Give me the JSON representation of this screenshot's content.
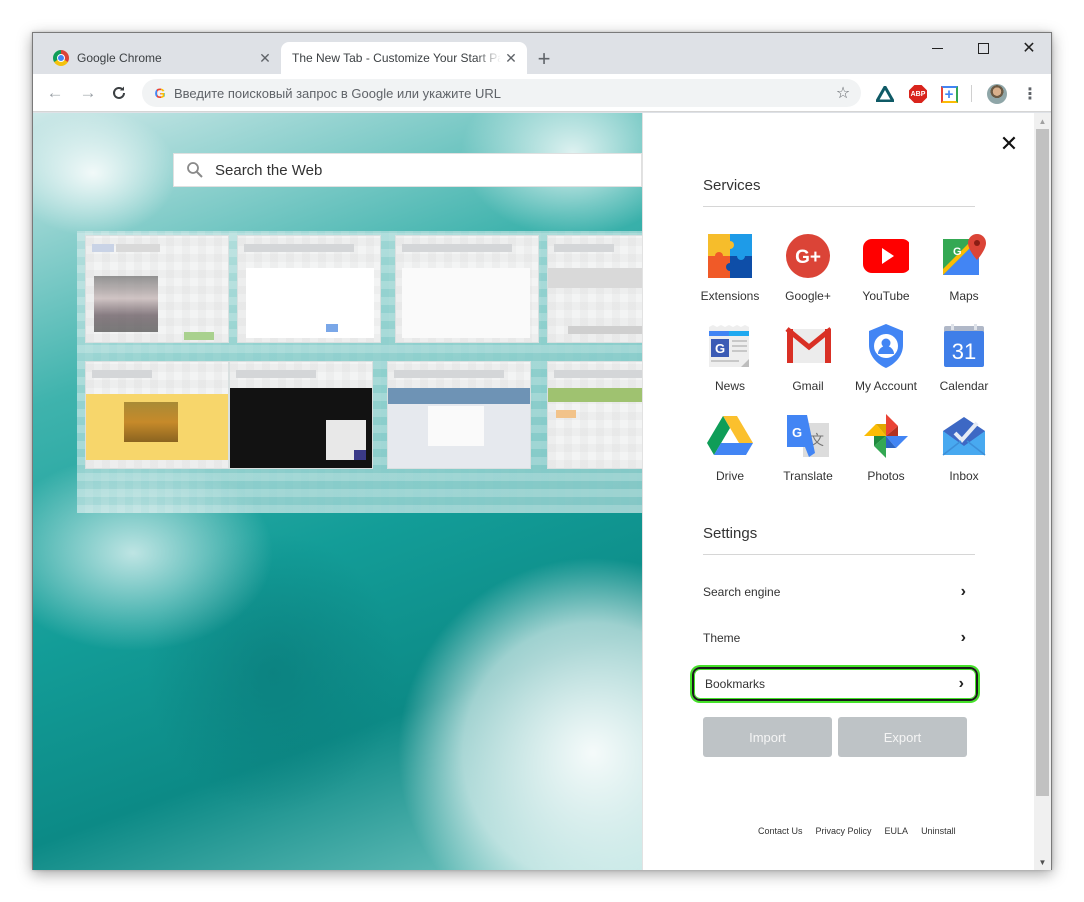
{
  "browser": {
    "tabs": [
      {
        "title": "Google Chrome",
        "active": false,
        "favicon": "chrome-icon"
      },
      {
        "title": "The New Tab - Customize Your Start Page",
        "active": true,
        "favicon": ""
      }
    ],
    "new_tab_glyph": "+",
    "tab_close_glyph": "✕",
    "window_controls": {
      "close_glyph": "✕"
    },
    "toolbar": {
      "back_glyph": "←",
      "forward_glyph": "→",
      "reload_glyph": "C",
      "omnibox_g": "G",
      "omnibox_placeholder": "Введите поисковый запрос в Google или укажите URL",
      "star_glyph": "☆",
      "extensions": [
        {
          "name": "arrow-extension-icon"
        },
        {
          "name": "adblock-plus-icon",
          "label": "ABP"
        },
        {
          "name": "plus-extension-icon",
          "label": "+"
        }
      ],
      "menu_glyph": "⋮"
    }
  },
  "page": {
    "search": {
      "placeholder": "Search the Web",
      "icon": "search-icon"
    },
    "panel": {
      "close_glyph": "✕",
      "services_title": "Services",
      "services": [
        {
          "label": "Extensions",
          "icon": "extensions-icon"
        },
        {
          "label": "Google+",
          "icon": "google-plus-icon"
        },
        {
          "label": "YouTube",
          "icon": "youtube-icon"
        },
        {
          "label": "Maps",
          "icon": "maps-icon"
        },
        {
          "label": "News",
          "icon": "news-icon"
        },
        {
          "label": "Gmail",
          "icon": "gmail-icon"
        },
        {
          "label": "My Account",
          "icon": "my-account-icon"
        },
        {
          "label": "Calendar",
          "icon": "calendar-icon",
          "glyph": "31"
        },
        {
          "label": "Drive",
          "icon": "drive-icon"
        },
        {
          "label": "Translate",
          "icon": "translate-icon"
        },
        {
          "label": "Photos",
          "icon": "photos-icon"
        },
        {
          "label": "Inbox",
          "icon": "inbox-icon"
        }
      ],
      "settings_title": "Settings",
      "settings": [
        {
          "label": "Search engine",
          "focused": false
        },
        {
          "label": "Theme",
          "focused": false
        },
        {
          "label": "Bookmarks",
          "focused": true
        }
      ],
      "chevron_glyph": "›",
      "import_label": "Import",
      "export_label": "Export",
      "footer_links": [
        "Contact Us",
        "Privacy Policy",
        "EULA",
        "Uninstall"
      ]
    },
    "scrollbar": {
      "up_glyph": "▲",
      "down_glyph": "▼"
    }
  },
  "colors": {
    "focus_ring": "#45e12a",
    "button_grey": "#bec3c6",
    "ocean_teal": "#139d98"
  }
}
